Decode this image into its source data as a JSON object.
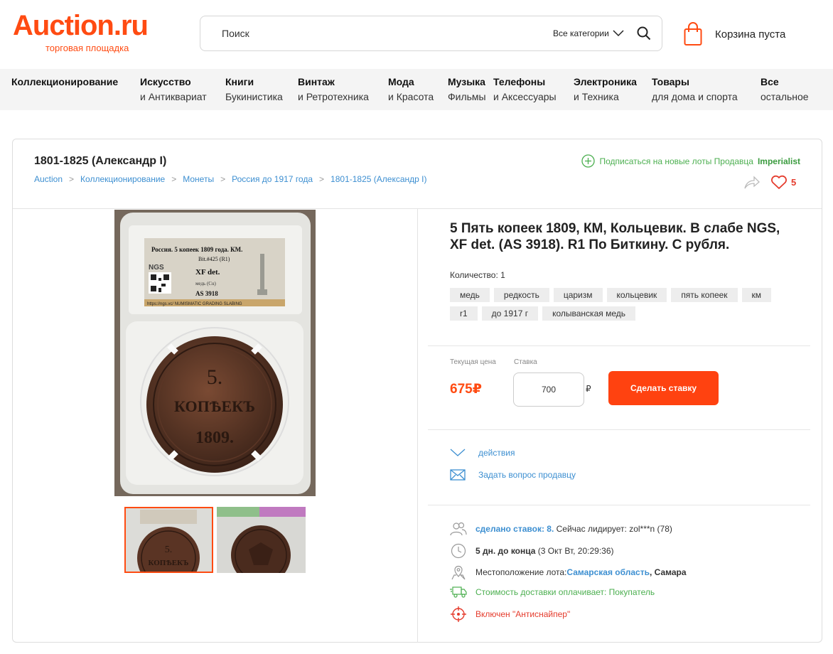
{
  "header": {
    "logo": "Auction.ru",
    "logo_sub": "торговая площадка",
    "search_placeholder": "Поиск",
    "category_select": "Все категории",
    "cart_label": "Корзина пуста"
  },
  "nav": [
    {
      "t1": "Коллекционирование",
      "t2": ""
    },
    {
      "t1": "Искусство",
      "t2": "и Антиквариат"
    },
    {
      "t1": "Книги",
      "t2": "Букинистика"
    },
    {
      "t1": "Винтаж",
      "t2": "и Ретротехника"
    },
    {
      "t1": "Мода",
      "t2": "и Красота"
    },
    {
      "t1": "Музыка",
      "t2": "Фильмы"
    },
    {
      "t1": "Телефоны",
      "t2": "и Аксессуары"
    },
    {
      "t1": "Электроника",
      "t2": "и Техника"
    },
    {
      "t1": "Товары",
      "t2": "для дома и спорта"
    },
    {
      "t1": "Все",
      "t2": "остальное"
    }
  ],
  "page": {
    "category_title": "1801-1825 (Александр I)",
    "breadcrumb": [
      "Auction",
      "Коллекционирование",
      "Монеты",
      "Россия до 1917 года",
      "1801-1825 (Александр I)"
    ],
    "breadcrumb_sep": ">",
    "subscribe_text": "Подписаться на новые лоты Продавца",
    "seller": "Imperialist",
    "favorites_count": "5"
  },
  "slab": {
    "line1": "Россия. 5 копеек 1809 года. КМ.",
    "line2": "Bit.#425 (R1)",
    "grade": "XF det.",
    "metal": "медь (Cu)",
    "cert": "AS 3918",
    "brand": "NGS",
    "footer": "https://ngs.vc/   NUMISMATIC GRADING SLABING"
  },
  "coin": {
    "denom": "5.",
    "word": "КОПѢЕКЪ",
    "year": "1809."
  },
  "lot": {
    "title": "5 Пять копеек 1809, КМ, Кольцевик. В слабе NGS, XF det. (AS 3918). R1 По Биткину. С рубля.",
    "quantity": "Количество: 1",
    "tags": [
      "медь",
      "редкость",
      "царизм",
      "кольцевик",
      "пять копеек",
      "км",
      "r1",
      "до 1917 г",
      "колыванская медь"
    ]
  },
  "bidding": {
    "current_price_label": "Текущая цена",
    "bid_label": "Ставка",
    "current_price": "675₽",
    "bid_value": "700",
    "currency": "₽",
    "bid_button": "Сделать ставку"
  },
  "actions": {
    "actions_label": "действия",
    "ask_label": "Задать вопрос продавцу"
  },
  "info": {
    "bids_made": "сделано ставок: 8.",
    "leader": "Сейчас лидирует: zol***n (78)",
    "time_left": "5 дн. до конца",
    "end_date": "(3 Окт Вт, 20:29:36)",
    "location_label": "Местоположение лота:",
    "region": "Самарская область",
    "city": ", Самара",
    "shipping": "Стоимость доставки оплачивает: Покупатель",
    "antisniper": "Включен \"Антиснайпер\""
  },
  "colors": {
    "brand": "#ff4b12",
    "link": "#3d8fd1",
    "green": "#4caf50",
    "red": "#e53b2c"
  }
}
